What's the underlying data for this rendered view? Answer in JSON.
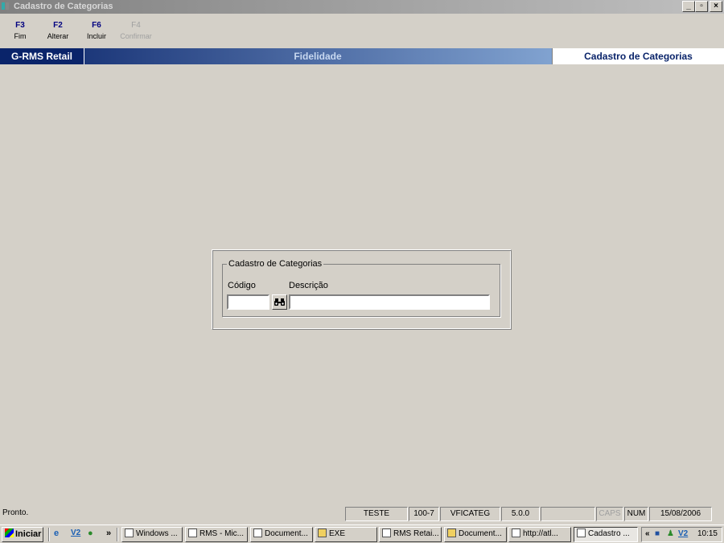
{
  "window": {
    "title": "Cadastro de Categorias",
    "icon_text": "RMS"
  },
  "toolbar": {
    "keys": [
      {
        "key": "F3",
        "label": "Fim",
        "enabled": true
      },
      {
        "key": "F2",
        "label": "Alterar",
        "enabled": true
      },
      {
        "key": "F6",
        "label": "Incluir",
        "enabled": true
      },
      {
        "key": "F4",
        "label": "Confirmar",
        "enabled": false
      }
    ]
  },
  "banner": {
    "brand": "G-RMS Retail",
    "module": "Fidelidade",
    "screen": "Cadastro de Categorias"
  },
  "form": {
    "group_title": "Cadastro de Categorias",
    "codigo_label": "Código",
    "codigo_value": "",
    "descricao_label": "Descrição",
    "descricao_value": ""
  },
  "status": {
    "message": "Pronto.",
    "env": "TESTE",
    "code": "100-7",
    "program": "VFICATEG",
    "version": "5.0.0",
    "caps": "CAPS",
    "num": "NUM",
    "date": "15/08/2006"
  },
  "taskbar": {
    "start_label": "Iniciar",
    "tasks": [
      {
        "label": "Windows ...",
        "active": false
      },
      {
        "label": "RMS - Mic...",
        "active": false
      },
      {
        "label": "Document...",
        "active": false
      },
      {
        "label": "EXE",
        "active": false
      },
      {
        "label": "RMS Retai...",
        "active": false
      },
      {
        "label": "Document...",
        "active": false
      },
      {
        "label": "http://atl...",
        "active": false
      },
      {
        "label": "Cadastro ...",
        "active": true
      }
    ],
    "clock": "10:15",
    "chevron": "»",
    "tray_chevron": "«"
  },
  "icons": {
    "minimize": "_",
    "maximize": "▫",
    "close": "×",
    "search": "🔍"
  }
}
